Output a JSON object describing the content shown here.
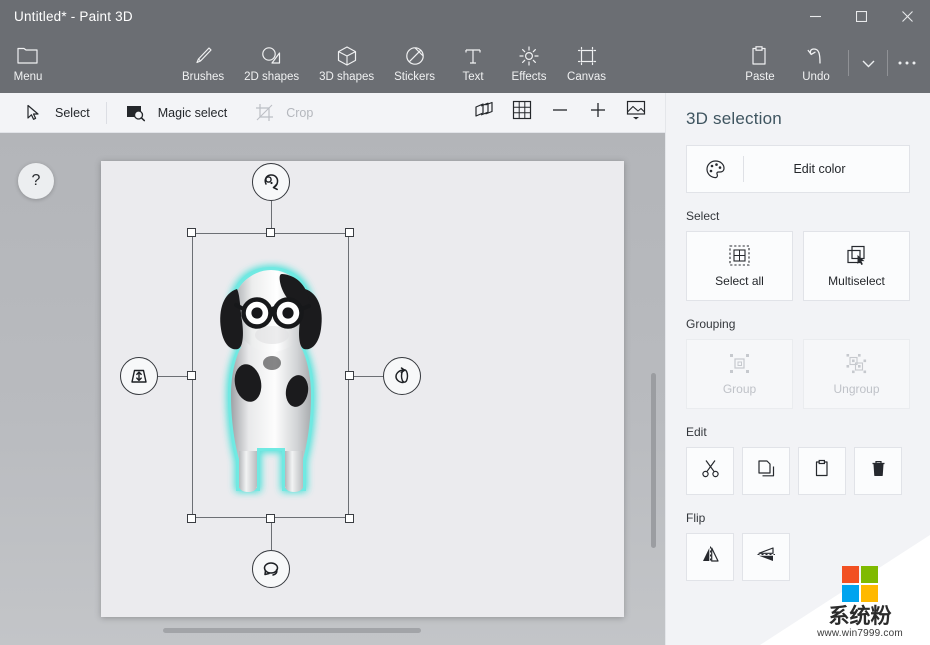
{
  "window": {
    "title": "Untitled* - Paint 3D",
    "minimize": "minimize-button",
    "maximize": "maximize-button",
    "close": "close-button"
  },
  "ribbon": {
    "items": [
      {
        "label": "Menu",
        "icon": "folder-icon"
      },
      {
        "label": "Brushes",
        "icon": "brush-icon"
      },
      {
        "label": "2D shapes",
        "icon": "2d-shapes-icon"
      },
      {
        "label": "3D shapes",
        "icon": "cube-icon"
      },
      {
        "label": "Stickers",
        "icon": "sticker-icon"
      },
      {
        "label": "Text",
        "icon": "text-icon"
      },
      {
        "label": "Effects",
        "icon": "effects-icon"
      },
      {
        "label": "Canvas",
        "icon": "canvas-icon"
      }
    ],
    "right_items": [
      {
        "label": "Paste",
        "icon": "clipboard-icon"
      },
      {
        "label": "Undo",
        "icon": "undo-icon"
      }
    ],
    "more_dropdown": "chevron-down-icon",
    "more_menu": "ellipsis-icon"
  },
  "subbar": {
    "select_label": "Select",
    "magic_select_label": "Magic select",
    "crop_label": "Crop",
    "crop_disabled": true,
    "view3d_icon": "3d-view-icon",
    "grid_icon": "grid-icon",
    "zoom_out_icon": "minus-icon",
    "zoom_in_icon": "plus-icon",
    "image_icon": "image-icon"
  },
  "workspace": {
    "help_label": "?",
    "canvas_color": "#ebebee",
    "selection_glow_color": "#68e6e0",
    "gizmos": [
      {
        "name": "rotate-z-handle",
        "position": "top"
      },
      {
        "name": "depth-handle",
        "position": "left"
      },
      {
        "name": "rotate-y-handle",
        "position": "right"
      },
      {
        "name": "rotate-horizontal-handle",
        "position": "bottom"
      }
    ]
  },
  "panel": {
    "title": "3D selection",
    "edit_color": {
      "label": "Edit color",
      "icon": "palette-icon"
    },
    "select_section": {
      "label": "Select",
      "buttons": [
        {
          "label": "Select all",
          "icon": "select-all-icon",
          "disabled": false
        },
        {
          "label": "Multiselect",
          "icon": "multiselect-icon",
          "disabled": false
        }
      ]
    },
    "grouping_section": {
      "label": "Grouping",
      "buttons": [
        {
          "label": "Group",
          "icon": "group-icon",
          "disabled": true
        },
        {
          "label": "Ungroup",
          "icon": "ungroup-icon",
          "disabled": true
        }
      ]
    },
    "edit_section": {
      "label": "Edit",
      "buttons": [
        {
          "name": "cut-button",
          "icon": "scissors-icon"
        },
        {
          "name": "copy-button",
          "icon": "copy-icon"
        },
        {
          "name": "paste-button",
          "icon": "clipboard-icon"
        },
        {
          "name": "delete-button",
          "icon": "trash-icon"
        }
      ]
    },
    "flip_section": {
      "label": "Flip",
      "buttons": [
        {
          "name": "flip-horizontal-button",
          "icon": "flip-horizontal-icon"
        },
        {
          "name": "flip-vertical-button",
          "icon": "flip-vertical-icon"
        }
      ]
    }
  },
  "watermark": {
    "text_cn": "系统粉",
    "url": "www.win7999.com",
    "logo_colors": [
      "#f25022",
      "#7fba00",
      "#00a4ef",
      "#ffb900"
    ]
  }
}
